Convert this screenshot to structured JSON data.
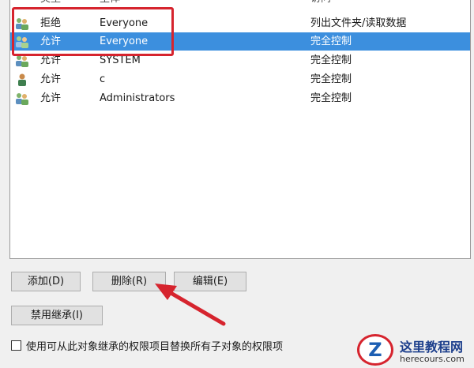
{
  "permissions": {
    "columns": {
      "type": "类型",
      "principal": "主体",
      "access": "访问"
    },
    "rows": [
      {
        "type": "拒绝",
        "principal": "Everyone",
        "access": "列出文件夹/读取数据",
        "icon": "group-users-icon",
        "selected": false
      },
      {
        "type": "允许",
        "principal": "Everyone",
        "access": "完全控制",
        "icon": "group-users-icon",
        "selected": true
      },
      {
        "type": "允许",
        "principal": "SYSTEM",
        "access": "完全控制",
        "icon": "group-users-icon",
        "selected": false
      },
      {
        "type": "允许",
        "principal": "c",
        "access": "完全控制",
        "icon": "single-user-icon",
        "selected": false
      },
      {
        "type": "允许",
        "principal": "Administrators",
        "access": "完全控制",
        "icon": "group-users-icon",
        "selected": false
      }
    ]
  },
  "buttons": {
    "add": "添加(D)",
    "remove": "删除(R)",
    "edit": "编辑(E)",
    "disable_inheritance": "禁用继承(I)"
  },
  "checkbox": {
    "label": "使用可从此对象继承的权限项目替换所有子对象的权限项",
    "checked": false
  },
  "watermark": {
    "title": "这里教程网",
    "url": "herecours.com",
    "logo_letter": "Z"
  },
  "colors": {
    "selection": "#3c8fde",
    "annotation_red": "#d6242e"
  }
}
